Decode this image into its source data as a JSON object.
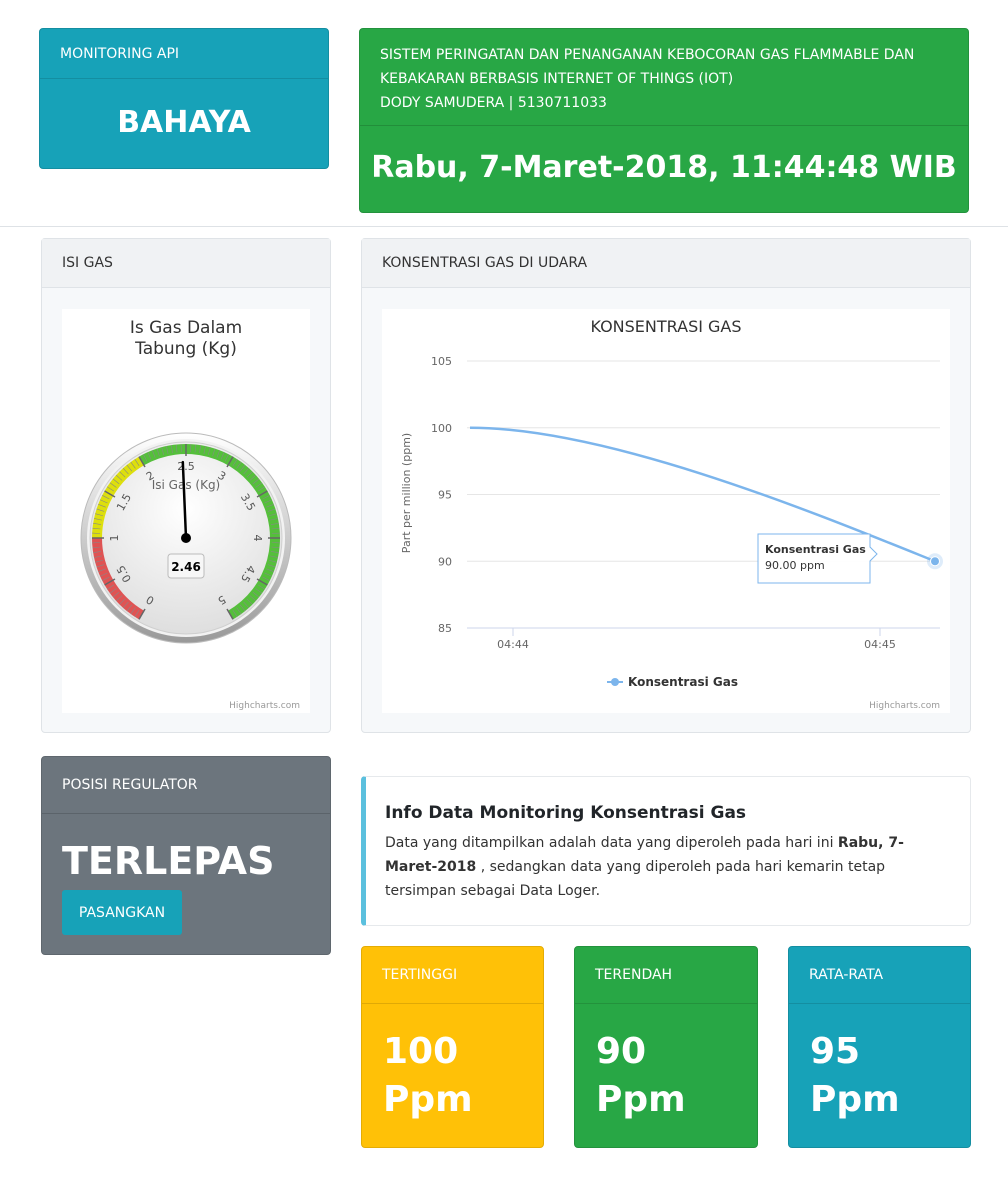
{
  "monitoring_api": {
    "header": "MONITORING API",
    "status": "BAHAYA"
  },
  "title_card": {
    "line1": "SISTEM PERINGATAN DAN PENANGANAN KEBOCORAN GAS FLAMMABLE DAN",
    "line2": "KEBAKARAN BERBASIS INTERNET OF THINGS (IOT)",
    "line3": "DODY SAMUDERA | 5130711033",
    "datetime": "Rabu, 7-Maret-2018, 11:44:48 WIB"
  },
  "isi_gas": {
    "header": "ISI GAS",
    "chart_title_line1": "Is Gas Dalam",
    "chart_title_line2": "Tabung (Kg)",
    "gauge_label": "Isi Gas (Kg)",
    "ticks": [
      "0",
      "0.5",
      "1",
      "1.5",
      "2",
      "2.5",
      "3",
      "3.5",
      "4",
      "4.5",
      "5"
    ],
    "credit": "Highcharts.com"
  },
  "konsentrasi": {
    "header": "KONSENTRASI GAS DI UDARA",
    "tooltip_title": "Konsentrasi Gas",
    "tooltip_value": "90.00 ppm",
    "credit": "Highcharts.com"
  },
  "chart_data": [
    {
      "type": "gauge",
      "title": "Is Gas Dalam Tabung (Kg)",
      "series_name": "Isi Gas (Kg)",
      "value": 2.46,
      "value_label": "2.46",
      "min": 0,
      "max": 5,
      "bands": [
        {
          "from": 0,
          "to": 1,
          "color": "#df5353"
        },
        {
          "from": 1,
          "to": 2,
          "color": "#dddf0d"
        },
        {
          "from": 2,
          "to": 5,
          "color": "#55bf3b"
        }
      ]
    },
    {
      "type": "line",
      "title": "KONSENTRASI GAS",
      "ylabel": "Part per million (ppm)",
      "xlabel": "",
      "ylim": [
        85,
        105
      ],
      "yticks": [
        85,
        90,
        95,
        100,
        105
      ],
      "x_ticks": [
        "04:44",
        "04:45"
      ],
      "series": [
        {
          "name": "Konsentrasi Gas",
          "color": "#7cb5ec",
          "x": [
            "04:44",
            "04:45"
          ],
          "values": [
            100,
            90
          ]
        }
      ],
      "legend": "bottom"
    }
  ],
  "regulator": {
    "header": "POSISI REGULATOR",
    "status": "TERLEPAS",
    "button": "PASANGKAN"
  },
  "info": {
    "title": "Info Data Monitoring Konsentrasi Gas",
    "text_before": "Data yang ditampilkan adalah data yang diperoleh pada hari ini ",
    "text_bold": "Rabu, 7-Maret-2018",
    "text_after": " , sedangkan data yang diperoleh pada hari kemarin tetap tersimpan sebagai Data Loger."
  },
  "stats": {
    "max": {
      "label": "TERTINGGI",
      "value": "100",
      "unit": "Ppm"
    },
    "min": {
      "label": "TERENDAH",
      "value": "90",
      "unit": "Ppm"
    },
    "avg": {
      "label": "RATA-RATA",
      "value": "95",
      "unit": "Ppm"
    }
  }
}
